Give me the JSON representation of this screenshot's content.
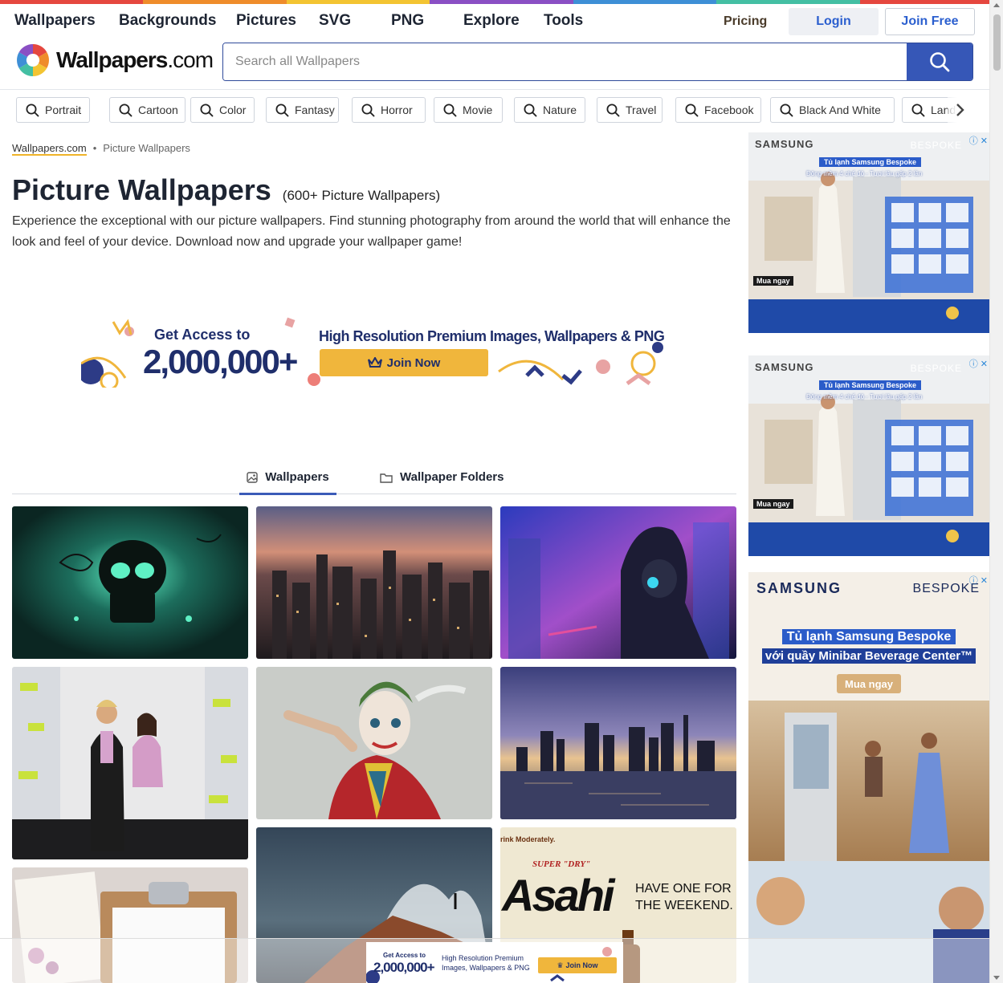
{
  "nav": {
    "items": [
      "Wallpapers",
      "Backgrounds",
      "Pictures",
      "SVG",
      "PNG",
      "Explore",
      "Tools"
    ],
    "pricing": "Pricing",
    "login": "Login",
    "join": "Join Free"
  },
  "stripe_colors": [
    "#e5473f",
    "#ef8c2b",
    "#f3c432",
    "#8a4fc4",
    "#3e8fd6",
    "#44bfa3",
    "#e5473f"
  ],
  "logo": {
    "main": "Wallpapers",
    "suffix": ".com"
  },
  "search": {
    "placeholder": "Search all Wallpapers"
  },
  "chips": [
    "Portrait",
    "Cartoon",
    "Color",
    "Fantasy",
    "Horror",
    "Movie",
    "Nature",
    "Travel",
    "Facebook",
    "Black And White",
    "Landscape"
  ],
  "breadcrumb": {
    "home": "Wallpapers.com",
    "sep": "•",
    "current": "Picture Wallpapers"
  },
  "page": {
    "title": "Picture Wallpapers",
    "count": "(600+ Picture Wallpapers)",
    "description": "Experience the exceptional with our picture wallpapers. Find stunning photography from around the world that will enhance the look and feel of your device. Download now and upgrade your wallpaper game!"
  },
  "promo": {
    "line1": "Get Access to",
    "line2": "2,000,000+",
    "headline": "High Resolution Premium Images, Wallpapers & PNG",
    "button": "Join Now"
  },
  "tabs": [
    "Wallpapers",
    "Wallpaper Folders"
  ],
  "ads": {
    "brand": "SAMSUNG",
    "sub": "BESPOKE",
    "headline_small": "Tủ lạnh Samsung Bespoke",
    "tagline_small": "Đông mềm 4 chế độ - Tươi lâu gấp 2 lần",
    "cta_small": "Mua ngay",
    "headline_big": "Tủ lạnh Samsung Bespoke",
    "tagline_big": "với quầy Minibar Beverage Center™",
    "cta_big": "Mua ngay"
  },
  "sticky": {
    "line1": "Get Access to",
    "line2": "2,000,000+",
    "headline": "High Resolution Premium Images, Wallpapers & PNG",
    "button": "Join Now"
  },
  "thumbs": {
    "beer_top": "rink Moderately.",
    "beer_brand": "Asahi",
    "beer_super": "SUPER \"DRY\"",
    "beer_tag": "HAVE ONE FOR THE WEEKEND."
  }
}
